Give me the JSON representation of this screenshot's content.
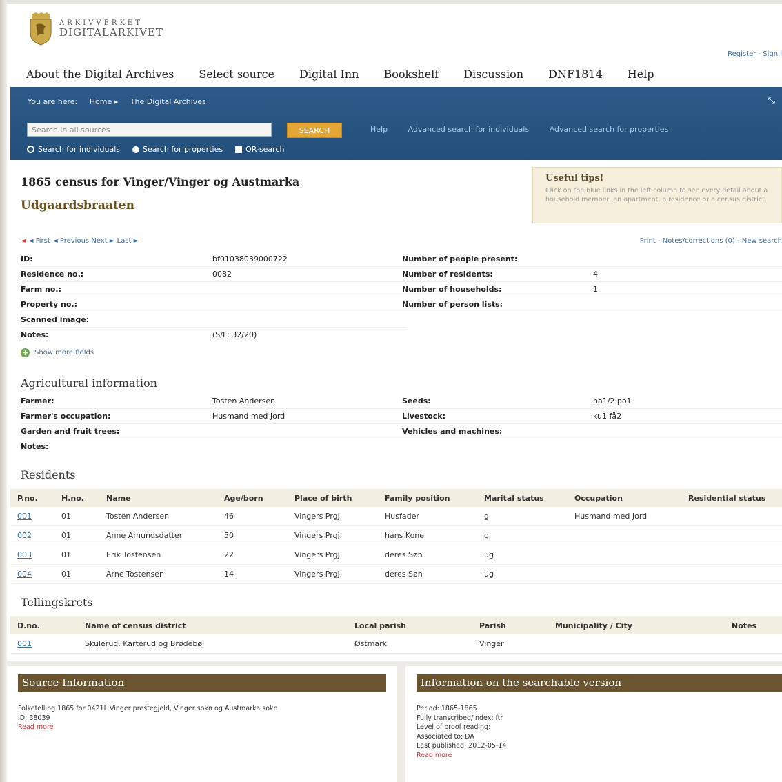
{
  "logo": {
    "line1": "ARKIVVERKET",
    "line2": "DIGITALARKIVET"
  },
  "register": "Register - Sign i",
  "mainnav": [
    "About the Digital Archives",
    "Select source",
    "Digital Inn",
    "Bookshelf",
    "Discussion",
    "DNF1814",
    "Help"
  ],
  "crumbs": {
    "label": "You are here:",
    "home": "Home ▸",
    "current": "The Digital Archives"
  },
  "search": {
    "placeholder": "Search in all sources",
    "button": "SEARCH",
    "help": "Help",
    "adv_individuals": "Advanced search for individuals",
    "adv_properties": "Advanced search for properties"
  },
  "radios": {
    "individuals": "Search for individuals",
    "properties": "Search for properties",
    "or": "OR-search"
  },
  "tips": {
    "title": "Useful tips!",
    "text": "Click on the blue links in the left column to see every detail about a household member, an apartment, a residence or a census district."
  },
  "title": "1865 census for Vinger/Vinger og Austmarka",
  "subtitle": "Udgaardsbraaten",
  "pager": {
    "first": "◄ First",
    "previous": "◄ Previous",
    "next": "Next ►",
    "last": "Last ►"
  },
  "tools": "Print - Notes/corrections (0) - New search",
  "info_left": [
    {
      "label": "ID:",
      "value": "bf01038039000722"
    },
    {
      "label": "Residence no.:",
      "value": "0082"
    },
    {
      "label": "Farm no.:",
      "value": ""
    },
    {
      "label": "Property no.:",
      "value": ""
    },
    {
      "label": "Scanned image:",
      "value": ""
    },
    {
      "label": "Notes:",
      "value": "(S/L: 32/20)"
    }
  ],
  "info_right": [
    {
      "label": "Number of people present:",
      "value": ""
    },
    {
      "label": "Number of residents:",
      "value": "4"
    },
    {
      "label": "Number of households:",
      "value": "1"
    },
    {
      "label": "Number of person lists:",
      "value": ""
    }
  ],
  "show_more": "Show more fields",
  "agri_title": "Agricultural information",
  "agri_left": [
    {
      "label": "Farmer:",
      "value": "Tosten Andersen"
    },
    {
      "label": "Farmer's occupation:",
      "value": "Husmand med Jord"
    },
    {
      "label": "Garden and fruit trees:",
      "value": ""
    },
    {
      "label": "Notes:",
      "value": ""
    }
  ],
  "agri_right": [
    {
      "label": "Seeds:",
      "value": "ha1/2 po1"
    },
    {
      "label": "Livestock:",
      "value": "ku1 få2"
    },
    {
      "label": "Vehicles and machines:",
      "value": ""
    }
  ],
  "residents_title": "Residents",
  "residents_headers": [
    "P.no.",
    "H.no.",
    "Name",
    "Age/born",
    "Place of birth",
    "Family position",
    "Marital status",
    "Occupation",
    "Residential status"
  ],
  "residents": [
    [
      "001",
      "01",
      "Tosten Andersen",
      "46",
      "Vingers Prgj.",
      "Husfader",
      "g",
      "Husmand med Jord",
      ""
    ],
    [
      "002",
      "01",
      "Anne Amundsdatter",
      "50",
      "Vingers Prgj.",
      "hans Kone",
      "g",
      "",
      ""
    ],
    [
      "003",
      "01",
      "Erik Tostensen",
      "22",
      "Vingers Prgj.",
      "deres Søn",
      "ug",
      "",
      ""
    ],
    [
      "004",
      "01",
      "Arne Tostensen",
      "14",
      "Vingers Prgj.",
      "deres Søn",
      "ug",
      "",
      ""
    ]
  ],
  "district_title": "Tellingskrets",
  "district_headers": [
    "D.no.",
    "Name of census district",
    "Local parish",
    "Parish",
    "Municipality / City",
    "Notes"
  ],
  "districts": [
    [
      "001",
      "Skulerud, Karterud og Brødebøl",
      "Østmark",
      "Vinger",
      "",
      ""
    ]
  ],
  "source": {
    "title": "Source Information",
    "line1": "Folketelling 1865 for 0421L Vinger prestegjeld, Vinger sokn og Austmarka sokn",
    "line2": "ID: 38039",
    "read_more": "Read more"
  },
  "searchable": {
    "title": "Information on the searchable version",
    "lines": [
      "Period: 1865-1865",
      "Fully transcribed/Index: ftr",
      "Level of proof reading:",
      "Associated to: DA",
      "Last published: 2012-05-14"
    ],
    "read_more": "Read more"
  }
}
